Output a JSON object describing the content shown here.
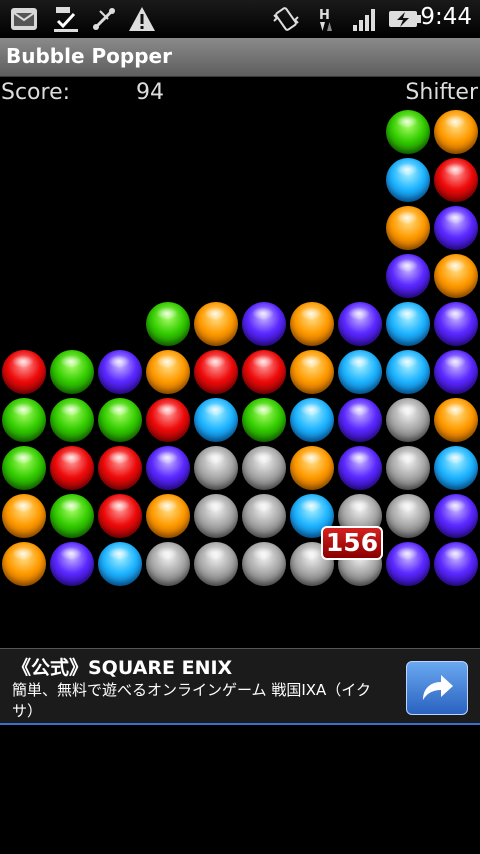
{
  "status_bar": {
    "icons": [
      "mail-icon",
      "download-done-icon",
      "usb-debug-icon",
      "warning-icon",
      "vibrate-icon",
      "h-data-icon",
      "signal-icon",
      "battery-charging-icon"
    ],
    "time": "9:44"
  },
  "app": {
    "title": "Bubble Popper"
  },
  "score": {
    "label": "Score:",
    "value": "94",
    "mode": "Shifter"
  },
  "board": {
    "columns": 10,
    "rows": 10,
    "cells": [
      [
        "empty",
        "empty",
        "empty",
        "empty",
        "empty",
        "empty",
        "empty",
        "empty",
        "green",
        "orange"
      ],
      [
        "empty",
        "empty",
        "empty",
        "empty",
        "empty",
        "empty",
        "empty",
        "empty",
        "blue",
        "red"
      ],
      [
        "empty",
        "empty",
        "empty",
        "empty",
        "empty",
        "empty",
        "empty",
        "empty",
        "orange",
        "purple"
      ],
      [
        "empty",
        "empty",
        "empty",
        "empty",
        "empty",
        "empty",
        "empty",
        "empty",
        "purple",
        "orange"
      ],
      [
        "empty",
        "empty",
        "empty",
        "green",
        "orange",
        "purple",
        "orange",
        "purple",
        "blue",
        "purple"
      ],
      [
        "red",
        "green",
        "purple",
        "orange",
        "red",
        "red",
        "orange",
        "blue",
        "blue",
        "purple"
      ],
      [
        "green",
        "green",
        "green",
        "red",
        "blue",
        "green",
        "blue",
        "purple",
        "gray",
        "orange"
      ],
      [
        "green",
        "red",
        "red",
        "purple",
        "gray",
        "gray",
        "orange",
        "purple",
        "gray",
        "blue"
      ],
      [
        "orange",
        "green",
        "red",
        "orange",
        "gray",
        "gray",
        "blue",
        "gray",
        "gray",
        "purple"
      ],
      [
        "orange",
        "purple",
        "blue",
        "gray",
        "gray",
        "gray",
        "gray",
        "gray",
        "purple",
        "purple"
      ]
    ],
    "popup": "156"
  },
  "ad": {
    "title": "《公式》SQUARE ENIX",
    "text": "簡単、無料で遊べるオンラインゲーム 戦国IXA（イクサ）",
    "button_icon": "share-arrow-icon"
  },
  "colors": {
    "green": "#33cc00",
    "orange": "#ff9a00",
    "blue": "#1eb4ff",
    "red": "#ee0a0a",
    "purple": "#5a28ff",
    "gray": "#a8a8a8"
  }
}
